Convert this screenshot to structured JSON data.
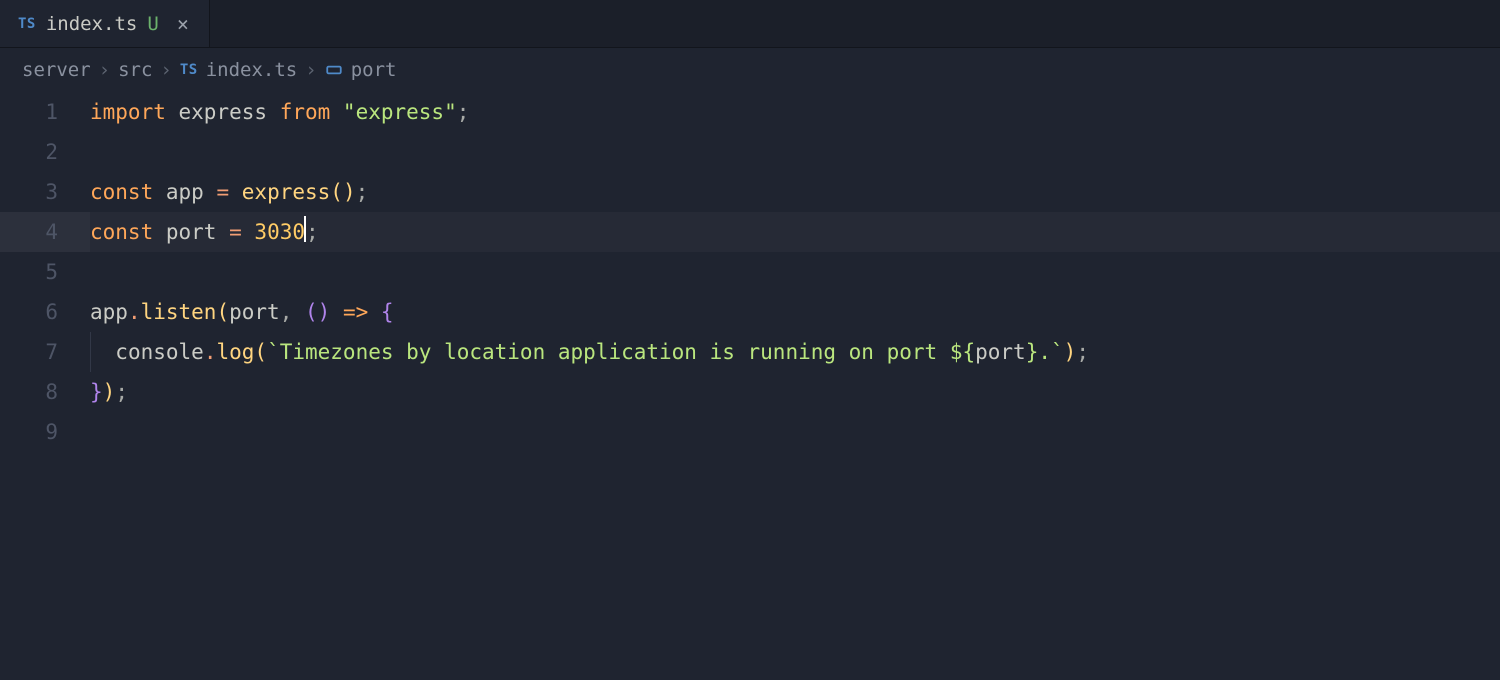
{
  "tab": {
    "icon": "TS",
    "name": "index.ts",
    "status": "U",
    "close": "×"
  },
  "breadcrumb": {
    "seg1": "server",
    "seg2": "src",
    "seg3_icon": "TS",
    "seg3": "index.ts",
    "seg4": "port",
    "sep": "›"
  },
  "gutter": [
    "1",
    "2",
    "3",
    "4",
    "5",
    "6",
    "7",
    "8",
    "9"
  ],
  "activeLine": 4,
  "code": {
    "l1": {
      "kw1": "import",
      "sp": " ",
      "id": "express",
      "kw2": "from",
      "str": "\"express\"",
      "semi": ";"
    },
    "l3": {
      "kw": "const",
      "name": "app",
      "eq": "=",
      "fn": "express",
      "lp": "(",
      "rp": ")",
      "semi": ";"
    },
    "l4": {
      "kw": "const",
      "name": "port",
      "eq": "=",
      "num": "3030",
      "semi": ";"
    },
    "l6": {
      "obj": "app",
      "dot": ".",
      "fn": "listen",
      "lp": "(",
      "arg1": "port",
      "comma": ", ",
      "lp2": "(",
      "rp2": ")",
      "arrow": "=>",
      "lb": "{"
    },
    "l7": {
      "indent": "  ",
      "obj": "console",
      "dot": ".",
      "fn": "log",
      "lp": "(",
      "tick": "`",
      "txt": "Timezones by location application is running on port ",
      "dollar": "$",
      "lb": "{",
      "var": "port",
      "rb": "}",
      "tail": ".",
      "tick2": "`",
      "rp": ")",
      "semi": ";"
    },
    "l8": {
      "rb": "}",
      "rp": ")",
      "semi": ";"
    }
  }
}
